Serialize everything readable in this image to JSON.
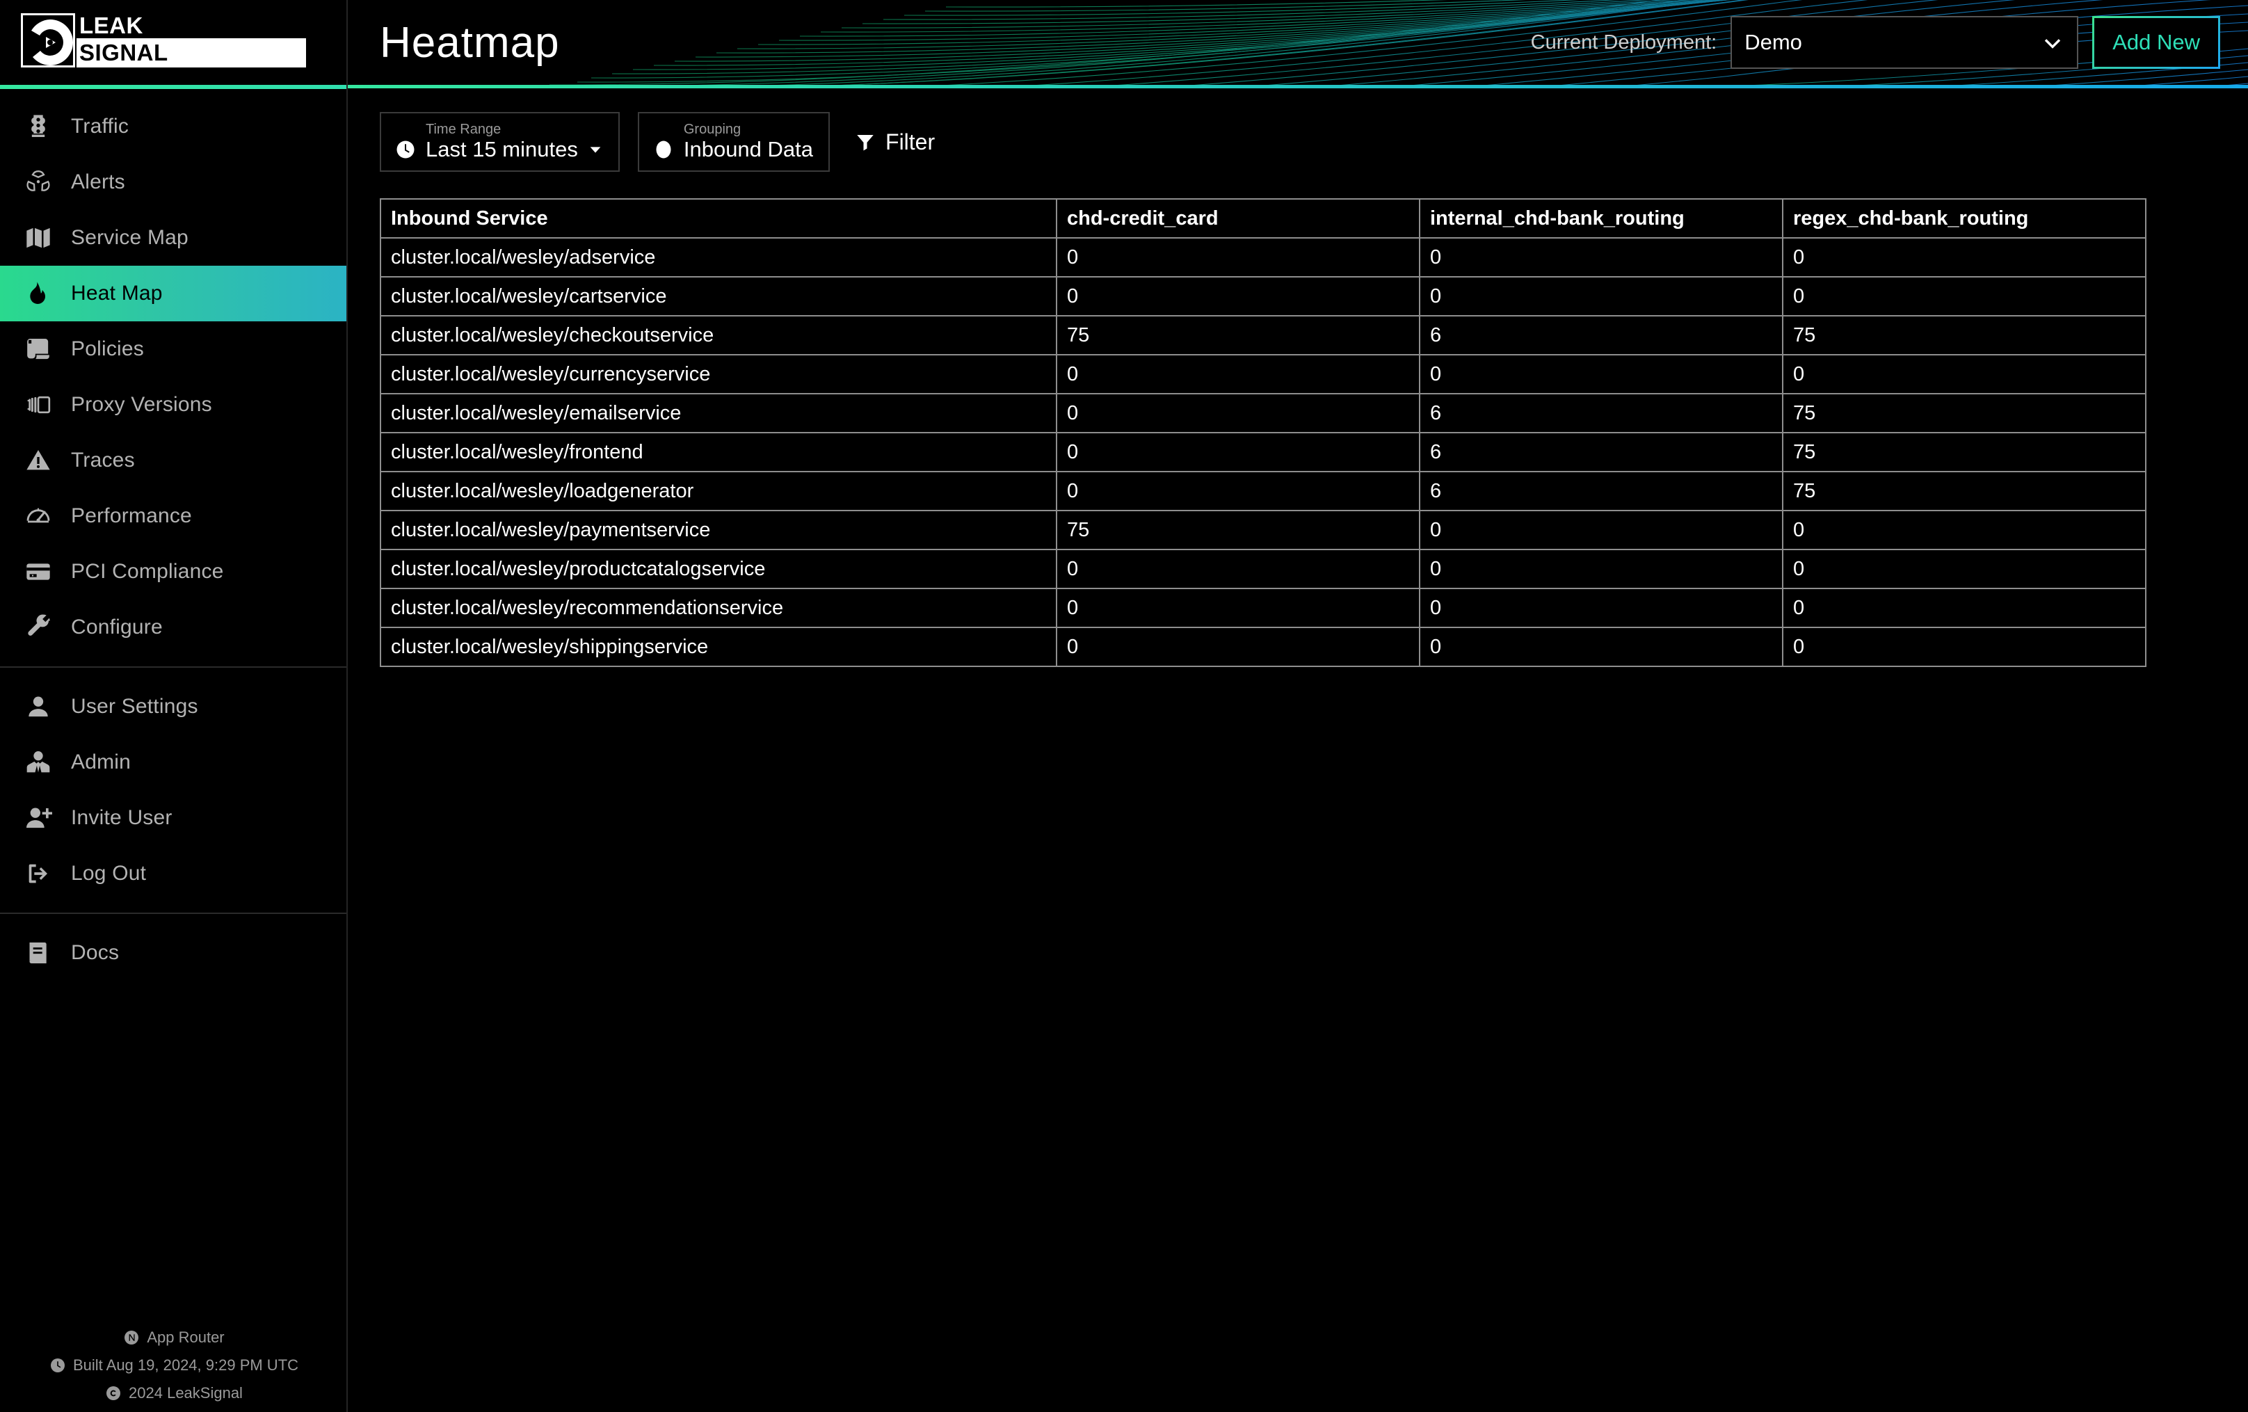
{
  "brand": {
    "line1": "LEAK",
    "line2": "SIGNAL"
  },
  "header": {
    "title": "Heatmap",
    "deployment_label": "Current Deployment:",
    "deployment_value": "Demo",
    "add_new_label": "Add New",
    "accent_start": "#35e8a0",
    "accent_end": "#16a9e8"
  },
  "sidebar": {
    "items": [
      {
        "label": "Traffic",
        "icon": "traffic-light-icon",
        "active": false
      },
      {
        "label": "Alerts",
        "icon": "radiation-icon",
        "active": false
      },
      {
        "label": "Service Map",
        "icon": "map-icon",
        "active": false
      },
      {
        "label": "Heat Map",
        "icon": "fire-icon",
        "active": true
      },
      {
        "label": "Policies",
        "icon": "scroll-icon",
        "active": false
      },
      {
        "label": "Proxy Versions",
        "icon": "layers-icon",
        "active": false
      },
      {
        "label": "Traces",
        "icon": "warning-triangle-icon",
        "active": false
      },
      {
        "label": "Performance",
        "icon": "gauge-icon",
        "active": false
      },
      {
        "label": "PCI Compliance",
        "icon": "credit-card-icon",
        "active": false
      },
      {
        "label": "Configure",
        "icon": "wrench-icon",
        "active": false
      }
    ],
    "account_items": [
      {
        "label": "User Settings",
        "icon": "user-icon"
      },
      {
        "label": "Admin",
        "icon": "user-tie-icon"
      },
      {
        "label": "Invite User",
        "icon": "user-plus-icon"
      },
      {
        "label": "Log Out",
        "icon": "logout-icon"
      }
    ],
    "docs_items": [
      {
        "label": "Docs",
        "icon": "book-icon"
      }
    ],
    "footer": {
      "router": "App Router",
      "build": "Built Aug 19, 2024, 9:29 PM UTC",
      "copyright": "2024 LeakSignal"
    }
  },
  "toolbar": {
    "time_range_caption": "Time Range",
    "time_range_value": "Last 15 minutes",
    "grouping_caption": "Grouping",
    "grouping_value": "Inbound Data",
    "filter_label": "Filter"
  },
  "chart_data": {
    "type": "heatmap",
    "title": "Heatmap",
    "xlabel": "",
    "ylabel": "Inbound Service",
    "categories": [
      "chd-credit_card",
      "internal_chd-bank_routing",
      "regex_chd-bank_routing"
    ],
    "row_header": "Inbound Service",
    "rows": [
      "cluster.local/wesley/adservice",
      "cluster.local/wesley/cartservice",
      "cluster.local/wesley/checkoutservice",
      "cluster.local/wesley/currencyservice",
      "cluster.local/wesley/emailservice",
      "cluster.local/wesley/frontend",
      "cluster.local/wesley/loadgenerator",
      "cluster.local/wesley/paymentservice",
      "cluster.local/wesley/productcatalogservice",
      "cluster.local/wesley/recommendationservice",
      "cluster.local/wesley/shippingservice"
    ],
    "values": [
      [
        0,
        0,
        0
      ],
      [
        0,
        0,
        0
      ],
      [
        75,
        6,
        75
      ],
      [
        0,
        0,
        0
      ],
      [
        0,
        6,
        75
      ],
      [
        0,
        6,
        75
      ],
      [
        0,
        6,
        75
      ],
      [
        75,
        0,
        0
      ],
      [
        0,
        0,
        0
      ],
      [
        0,
        0,
        0
      ],
      [
        0,
        0,
        0
      ]
    ],
    "hot_threshold": 75,
    "hot_color": "#4a0606",
    "cell_color": "#000000",
    "grid": true
  }
}
